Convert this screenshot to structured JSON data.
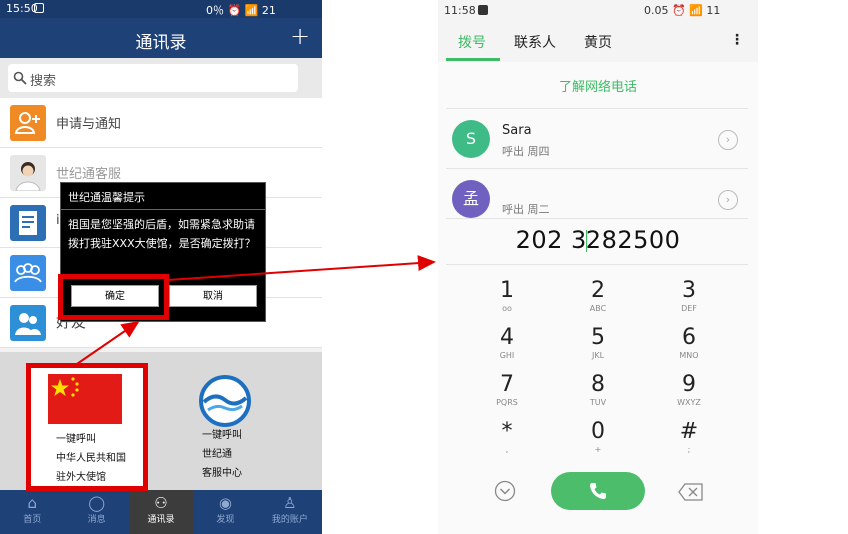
{
  "left": {
    "status": {
      "time": "15:50",
      "right": "0％ ⏰ 📶 21"
    },
    "header": {
      "title": "通讯录",
      "add_label": "+"
    },
    "search": {
      "placeholder": "搜索"
    },
    "list": [
      {
        "label": "申请与通知",
        "icon": "add-user-icon",
        "color": "#f08a24"
      },
      {
        "label": "世纪通客服",
        "icon": "agent-avatar",
        "color": "#dcdcdc"
      },
      {
        "label": "i",
        "icon": "document-icon",
        "color": "#2c6fb5"
      },
      {
        "label": "",
        "icon": "group-icon",
        "color": "#3a8ee6"
      },
      {
        "label": "好友",
        "icon": "friends-icon",
        "color": "#2d8fd5"
      }
    ],
    "shortcuts": [
      {
        "line1": "一键呼叫",
        "line2": "中华人民共和国",
        "line3": "驻外大使馆",
        "icon": "china-flag-icon"
      },
      {
        "line1": "一键呼叫",
        "line2": "世纪通",
        "line3": "客服中心",
        "icon": "shijitong-logo-icon"
      }
    ],
    "tabs": [
      {
        "label": "首页",
        "icon": "home-icon",
        "active": false
      },
      {
        "label": "消息",
        "icon": "message-icon",
        "active": false
      },
      {
        "label": "通讯录",
        "icon": "contacts-icon",
        "active": true
      },
      {
        "label": "发现",
        "icon": "discover-icon",
        "active": false
      },
      {
        "label": "我的账户",
        "icon": "account-icon",
        "active": false
      }
    ],
    "dialog": {
      "title": "世纪通温馨提示",
      "message": "祖国是您坚强的后盾，如需紧急求助请拨打我驻XXX大使馆，是否确定拨打？",
      "confirm": "确定",
      "cancel": "取消"
    },
    "colors": {
      "header": "#1e4178",
      "highlight": "#e00000"
    }
  },
  "right": {
    "status": {
      "time": "11:58",
      "right": "0.05 ⏰ 📶 11"
    },
    "tabs": [
      "拨号",
      "联系人",
      "黄页"
    ],
    "menu": "⋮",
    "link": "了解网络电话",
    "contacts": [
      {
        "initial": "S",
        "name": "Sara",
        "sub": "呼出  周四",
        "color": "#3fbb88"
      },
      {
        "initial": "孟",
        "name": "",
        "sub": "呼出  周二",
        "color": "#7060c0"
      }
    ],
    "number_a": "202  3",
    "number_b": "282500",
    "keys": [
      {
        "d": "1",
        "l": "oo"
      },
      {
        "d": "2",
        "l": "ABC"
      },
      {
        "d": "3",
        "l": "DEF"
      },
      {
        "d": "4",
        "l": "GHI"
      },
      {
        "d": "5",
        "l": "JKL"
      },
      {
        "d": "6",
        "l": "MNO"
      },
      {
        "d": "7",
        "l": "PQRS"
      },
      {
        "d": "8",
        "l": "TUV"
      },
      {
        "d": "9",
        "l": "WXYZ"
      },
      {
        "d": "*",
        "l": ","
      },
      {
        "d": "0",
        "l": "+"
      },
      {
        "d": "#",
        "l": ";"
      }
    ],
    "accent": "#3fbb66"
  }
}
